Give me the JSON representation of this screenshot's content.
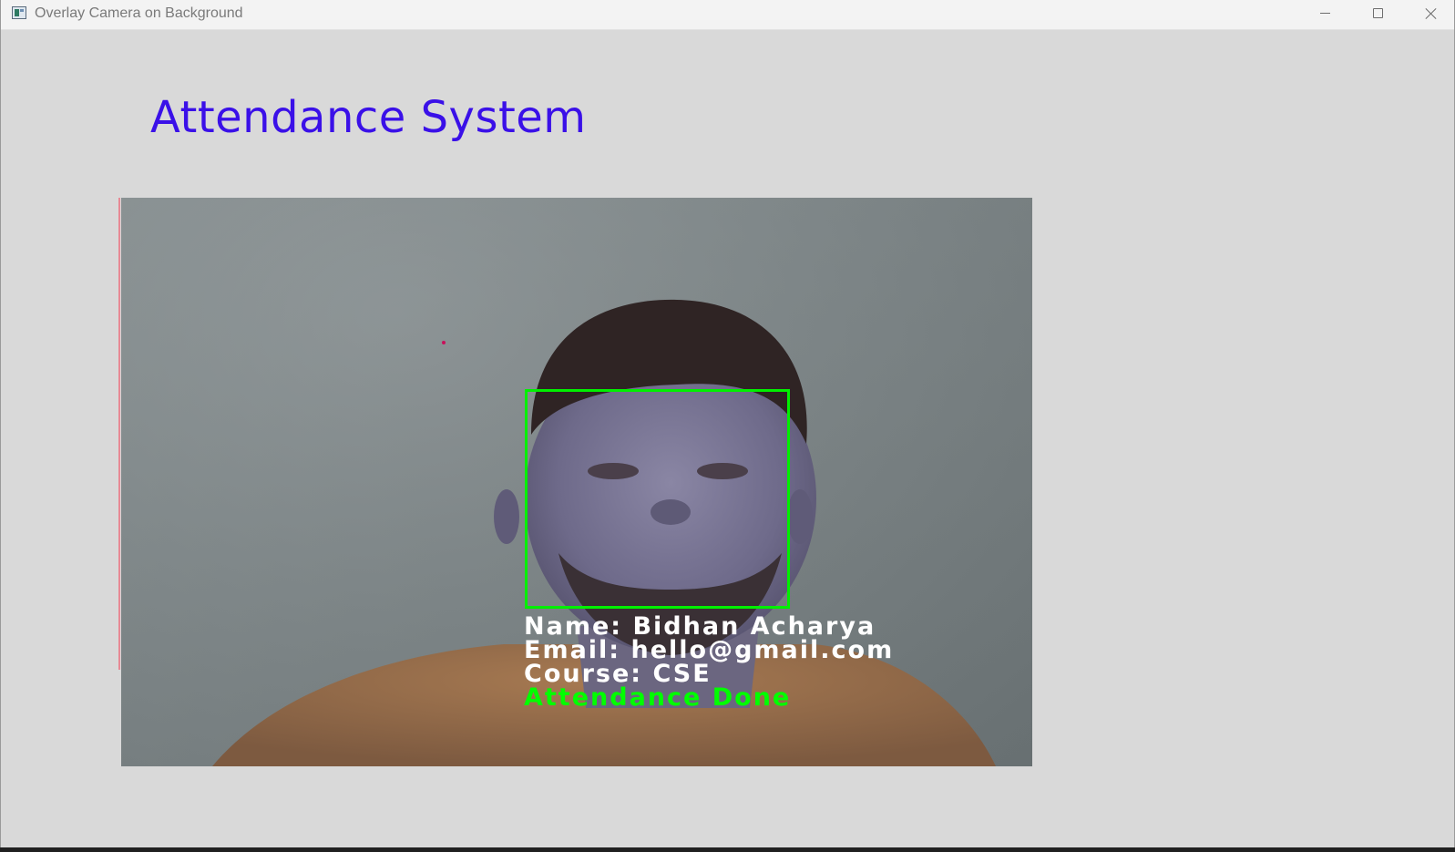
{
  "window": {
    "title": "Overlay Camera on Background",
    "icons": {
      "app": "app-window-icon",
      "minimize": "minimize-icon",
      "maximize": "maximize-icon",
      "close": "close-icon"
    }
  },
  "main": {
    "heading": "Attendance System",
    "heading_color": "#3a10e8"
  },
  "camera_feed": {
    "detection": {
      "box_color": "#00f000",
      "lines": {
        "name": "Name: Bidhan Acharya",
        "email": "Email: hello@gmail.com",
        "course": "Course: CSE",
        "status": "Attendance Done"
      },
      "status_color": "#00ff00"
    }
  }
}
